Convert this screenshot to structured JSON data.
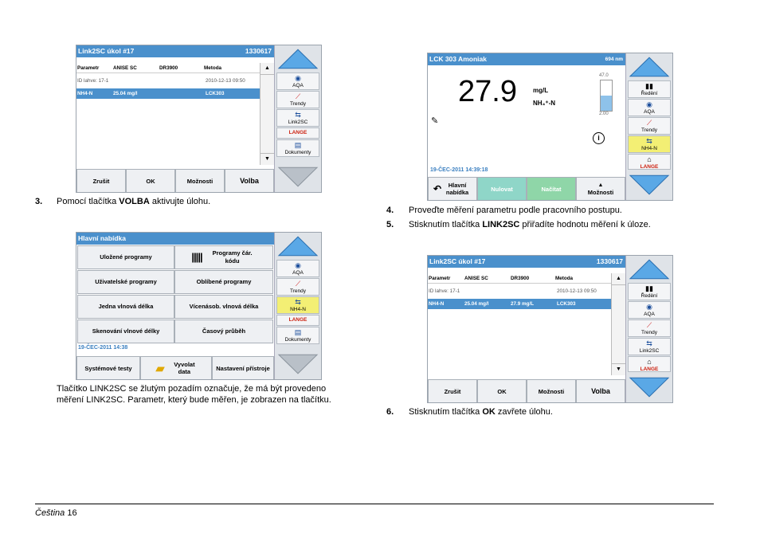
{
  "screen1": {
    "title": "Link2SC úkol #17",
    "id": "1330617",
    "headers": [
      "Parametr",
      "ANISE SC",
      "DR3900",
      "Metoda"
    ],
    "row1": [
      "ID lahve: 17-1",
      "2010-12-13 09:50"
    ],
    "row_sel": [
      "NH4-N",
      "25.04 mg/l",
      "LCK303"
    ],
    "buttons": [
      "Zrušit",
      "OK",
      "Možnosti",
      "Volba"
    ],
    "side": [
      "AQA",
      "Trendy",
      "Link2SC",
      "LANGE",
      "Dokumenty"
    ]
  },
  "step3": {
    "num": "3.",
    "pre": "Pomocí tlačítka ",
    "bold": "VOLBA",
    "post": " aktivujte úlohu."
  },
  "screen2": {
    "title": "Hlavní nabídka",
    "grid": [
      "Uložené programy",
      "Programy čár. kódu",
      "Uživatelské programy",
      "Oblíbené programy",
      "Jedna vlnová délka",
      "Vícenásob. vlnová délka",
      "Skenování vlnové délky",
      "Časový průběh"
    ],
    "date": "19-ČEC-2011  14:38",
    "buttons": [
      "Systémové testy",
      "Vyvolat data",
      "Nastavení přístroje"
    ],
    "side": [
      "AQA",
      "Trendy",
      "NH4-N",
      "LANGE",
      "Dokumenty"
    ]
  },
  "caption2": "Tlačítko LINK2SC se žlutým pozadím označuje, že má být provedeno měření LINK2SC. Parametr, který bude měřen, je zobrazen na tlačítku.",
  "screen3": {
    "title": "LCK 303 Amoniak",
    "wavelength": "694 nm",
    "value": "27.9",
    "unit": "mg/L",
    "species": "NH₄⁺-N",
    "scale_top": "47.0",
    "scale_bottom": "2.00",
    "level": 0.5,
    "date": "19-ČEC-2011  14:39:18",
    "buttons": [
      "Hlavní nabídka",
      "Nulovat",
      "Načítat",
      "Možnosti"
    ],
    "side": [
      "Ředění",
      "AQA",
      "Trendy",
      "NH4-N",
      "LANGE"
    ]
  },
  "step4": {
    "num": "4.",
    "text": "Proveďte měření parametru podle pracovního postupu."
  },
  "step5": {
    "num": "5.",
    "pre": "Stisknutím tlačítka ",
    "bold": "LINK2SC",
    "post": " přiřadíte hodnotu měření k úloze."
  },
  "screen4": {
    "title": "Link2SC úkol #17",
    "id": "1330617",
    "headers": [
      "Parametr",
      "ANISE SC",
      "DR3900",
      "Metoda"
    ],
    "row1": [
      "ID lahve: 17-1",
      "2010-12-13 09:50"
    ],
    "row_sel": [
      "NH4-N",
      "25.04 mg/l",
      "27.9 mg/L",
      "LCK303"
    ],
    "buttons": [
      "Zrušit",
      "OK",
      "Možnosti",
      "Volba"
    ],
    "side": [
      "Ředění",
      "AQA",
      "Trendy",
      "Link2SC",
      "LANGE"
    ]
  },
  "step6": {
    "num": "6.",
    "pre": "Stisknutím tlačítka ",
    "bold": "OK",
    "post": " zavřete úlohu."
  },
  "footer": {
    "lang": "Čeština",
    "page": "16"
  }
}
